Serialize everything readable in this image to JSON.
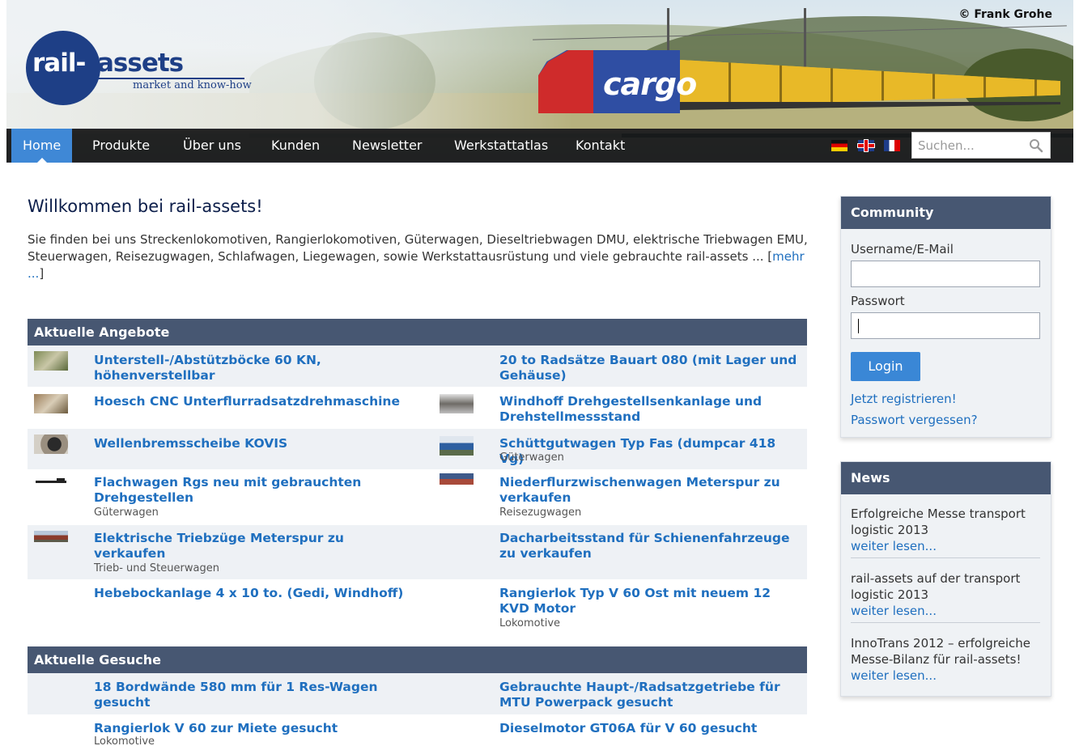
{
  "header": {
    "copyright": "© Frank Grohe",
    "logo_rail": "rail-",
    "logo_assets": "assets",
    "logo_tagline": "market and know-how",
    "train_text": "cargo"
  },
  "nav": {
    "items": [
      "Home",
      "Produkte",
      "Über uns",
      "Kunden",
      "Newsletter",
      "Werkstattatlas",
      "Kontakt"
    ],
    "active": "Home",
    "languages": [
      "de",
      "en",
      "fr"
    ],
    "search_placeholder": "Suchen..."
  },
  "main": {
    "title": "Willkommen bei rail-assets!",
    "intro": "Sie finden bei uns Streckenlokomotiven, Rangierlokomotiven, Güterwagen, Dieseltriebwagen DMU, elektrische Triebwagen EMU, Steuerwagen, Reisezugwagen, Schlafwagen, Liegewagen, sowie Werkstattausrüstung und viele gebrauchte rail-assets ... [",
    "more_link": "mehr ...",
    "intro_end": "]",
    "offers": {
      "heading": "Aktuelle Angebote",
      "rows": [
        {
          "left": {
            "title": "Unterstell-/Abstützböcke 60 KN, höhenverstellbar",
            "cat": ""
          },
          "right": {
            "title": "20 to Radsätze Bauart 080 (mit Lager und Gehäuse)",
            "cat": ""
          }
        },
        {
          "left": {
            "title": "Hoesch CNC Unterflurradsatzdrehmaschine",
            "cat": ""
          },
          "right": {
            "title": "Windhoff Drehgestellsenkanlage und Drehstellmessstand",
            "cat": ""
          }
        },
        {
          "left": {
            "title": "Wellenbremsscheibe KOVIS",
            "cat": ""
          },
          "right": {
            "title": "Schüttgutwagen Typ Fas (dumpcar 418 Vg)",
            "cat": "Güterwagen"
          }
        },
        {
          "left": {
            "title": "Flachwagen Rgs neu mit gebrauchten Drehgestellen",
            "cat": "Güterwagen"
          },
          "right": {
            "title": "Niederflurzwischenwagen Meterspur zu verkaufen",
            "cat": "Reisezugwagen"
          }
        },
        {
          "left": {
            "title": "Elektrische Triebzüge Meterspur zu verkaufen",
            "cat": "Trieb- und Steuerwagen"
          },
          "right": {
            "title": "Dacharbeitsstand für Schienenfahrzeuge zu verkaufen",
            "cat": ""
          }
        },
        {
          "left": {
            "title": "Hebebockanlage 4 x 10 to. (Gedi, Windhoff)",
            "cat": ""
          },
          "right": {
            "title": "Rangierlok Typ V 60 Ost mit neuem 12 KVD Motor",
            "cat": "Lokomotive"
          }
        }
      ]
    },
    "requests": {
      "heading": "Aktuelle Gesuche",
      "rows": [
        {
          "left": {
            "title": "18 Bordwände 580 mm für 1 Res-Wagen gesucht",
            "cat": ""
          },
          "right": {
            "title": "Gebrauchte Haupt-/Radsatzgetriebe für MTU Powerpack gesucht",
            "cat": ""
          }
        },
        {
          "left": {
            "title": "Rangierlok V 60 zur Miete gesucht",
            "cat": "Lokomotive"
          },
          "right": {
            "title": "Dieselmotor GT06A für V 60 gesucht",
            "cat": ""
          }
        }
      ]
    }
  },
  "sidebar": {
    "community": {
      "heading": "Community",
      "username_label": "Username/E-Mail",
      "password_label": "Passwort",
      "login": "Login",
      "register": "Jetzt registrieren!",
      "forgot": "Passwort vergessen?"
    },
    "news": {
      "heading": "News",
      "items": [
        {
          "text": "Erfolgreiche Messe transport logistic 2013",
          "more": "weiter lesen..."
        },
        {
          "text": "rail-assets auf der transport logistic 2013",
          "more": "weiter lesen..."
        },
        {
          "text": "InnoTrans 2012 – erfolgreiche Messe-Bilanz für rail-assets!",
          "more": "weiter lesen..."
        }
      ]
    }
  },
  "colors": {
    "nav_active": "#3f88d6",
    "section_head": "#475772",
    "link": "#1f6fbf",
    "logo_blue": "#1e3f86"
  }
}
